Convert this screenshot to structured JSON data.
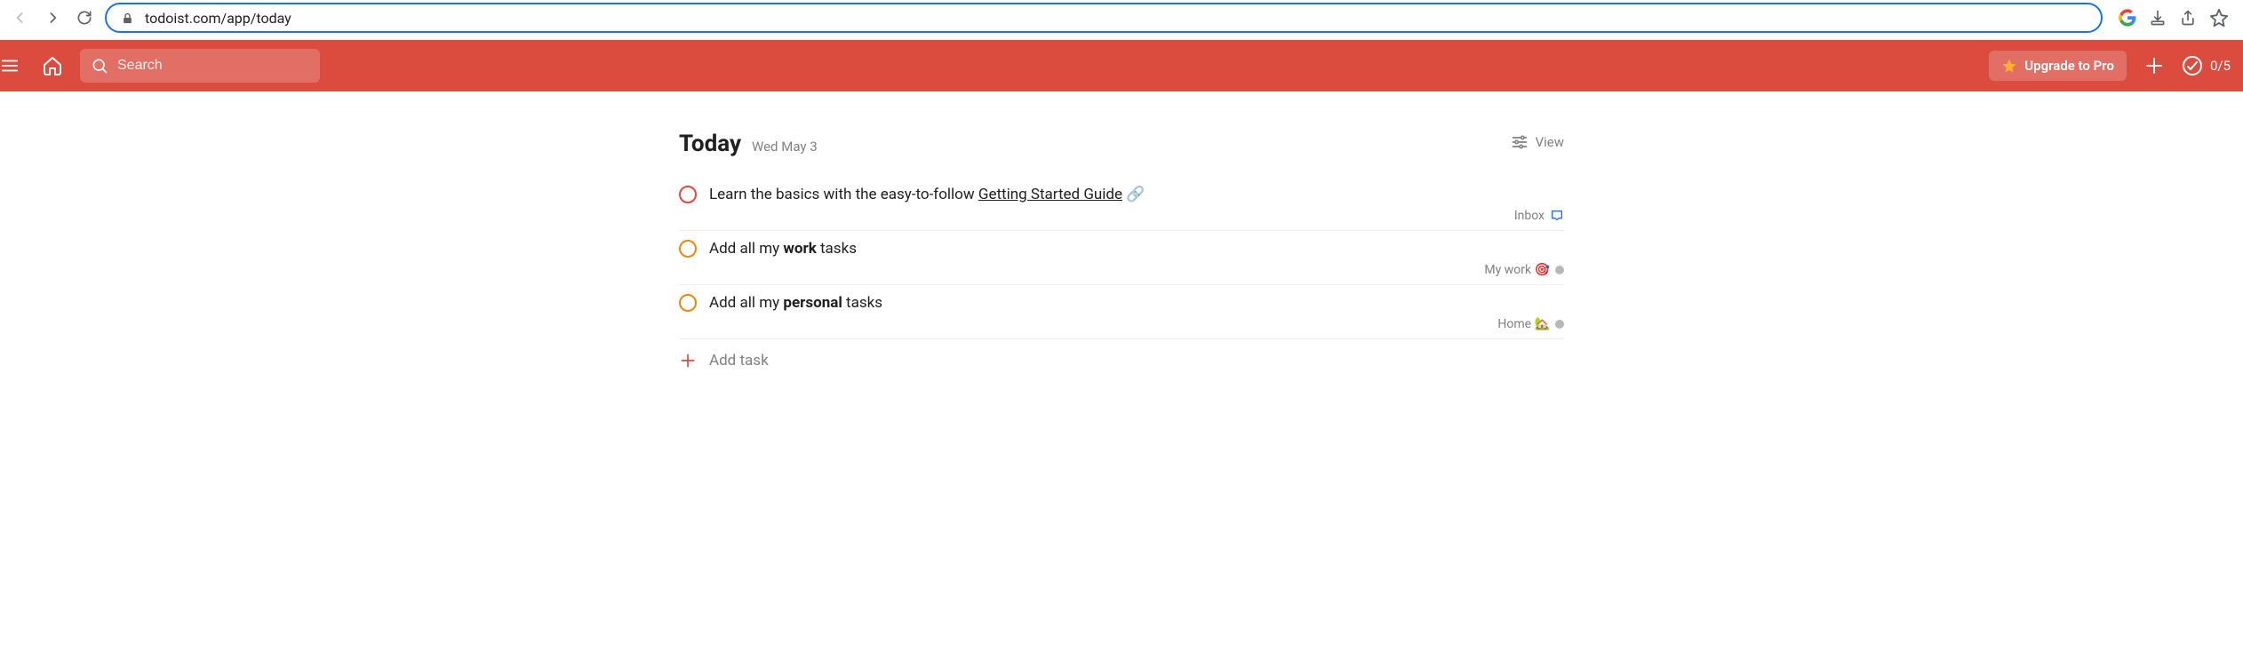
{
  "browser": {
    "url": "todoist.com/app/today"
  },
  "topbar": {
    "search_placeholder": "Search",
    "upgrade_label": "Upgrade to Pro",
    "productivity": "0/5"
  },
  "main": {
    "title": "Today",
    "date": "Wed May 3",
    "view_label": "View",
    "add_task_label": "Add task",
    "tasks": [
      {
        "priority": "p1",
        "title_pre": "Learn the basics with the easy-to-follow ",
        "title_link": "Getting Started Guide",
        "title_post": "",
        "has_link_icon": true,
        "project": "Inbox",
        "project_icon": "inbox"
      },
      {
        "priority": "p3",
        "title_pre": "Add all my ",
        "title_bold": "work",
        "title_post": " tasks",
        "project": "My work 🎯",
        "project_icon": "dot"
      },
      {
        "priority": "p3",
        "title_pre": "Add all my ",
        "title_bold": "personal",
        "title_post": " tasks",
        "project": "Home 🏡",
        "project_icon": "dot"
      }
    ]
  }
}
